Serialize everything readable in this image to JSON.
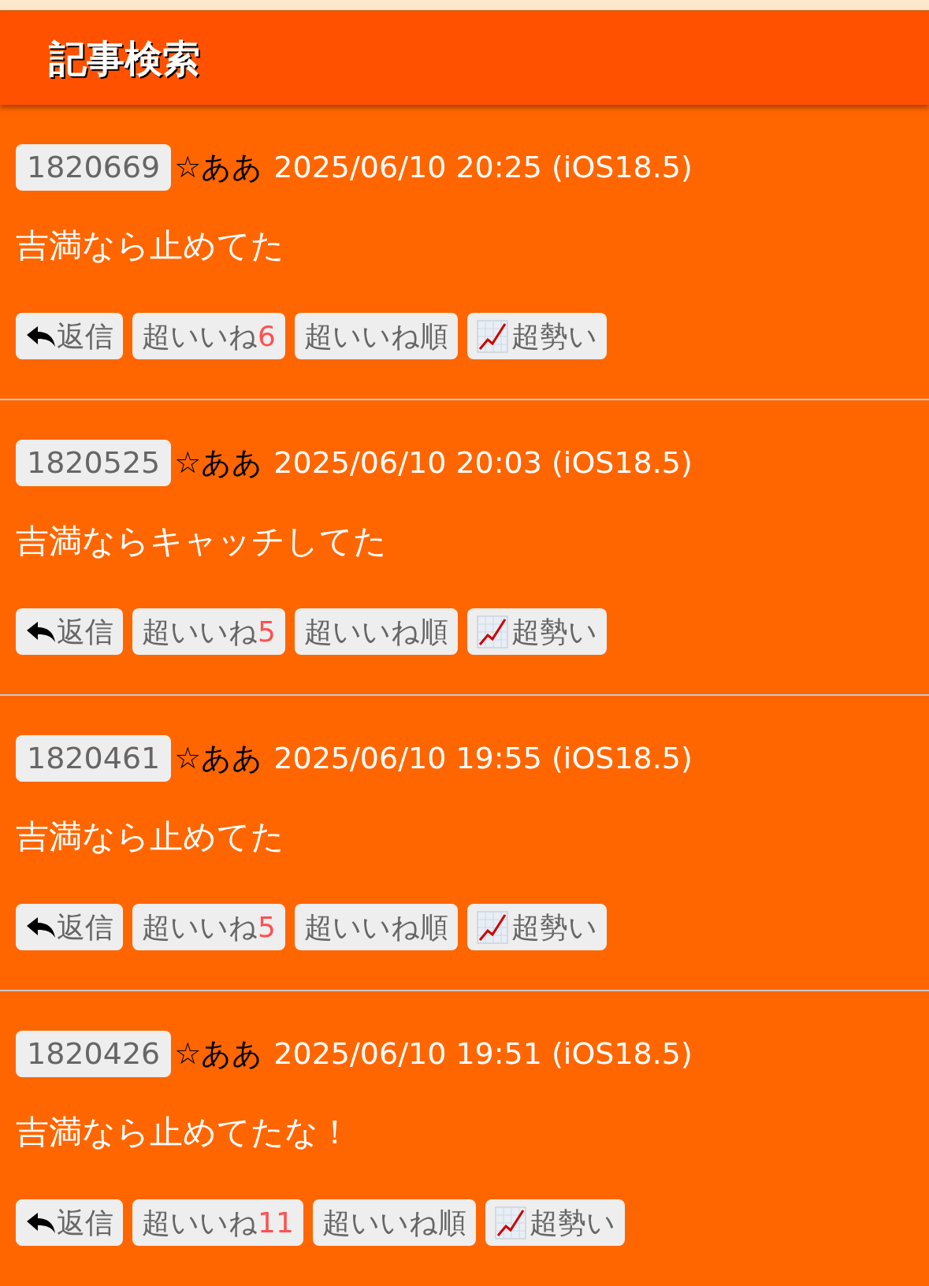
{
  "header": {
    "title": "記事検索"
  },
  "posts": [
    {
      "id": "1820669",
      "author": "☆ああ",
      "date": "2025/06/10 20:25 (iOS18.5)",
      "message": "吉満なら止めてた",
      "reply": "返信",
      "like_label": "超いいね",
      "like_count": "6",
      "sort": "超いいね順",
      "trend": "超勢い"
    },
    {
      "id": "1820525",
      "author": "☆ああ",
      "date": "2025/06/10 20:03 (iOS18.5)",
      "message": "吉満ならキャッチしてた",
      "reply": "返信",
      "like_label": "超いいね",
      "like_count": "5",
      "sort": "超いいね順",
      "trend": "超勢い"
    },
    {
      "id": "1820461",
      "author": "☆ああ",
      "date": "2025/06/10 19:55 (iOS18.5)",
      "message": "吉満なら止めてた",
      "reply": "返信",
      "like_label": "超いいね",
      "like_count": "5",
      "sort": "超いいね順",
      "trend": "超勢い"
    },
    {
      "id": "1820426",
      "author": "☆ああ",
      "date": "2025/06/10 19:51 (iOS18.5)",
      "message": "吉満なら止めてたな！",
      "reply": "返信",
      "like_label": "超いいね",
      "like_count": "11",
      "sort": "超いいね順",
      "trend": "超勢い"
    }
  ]
}
